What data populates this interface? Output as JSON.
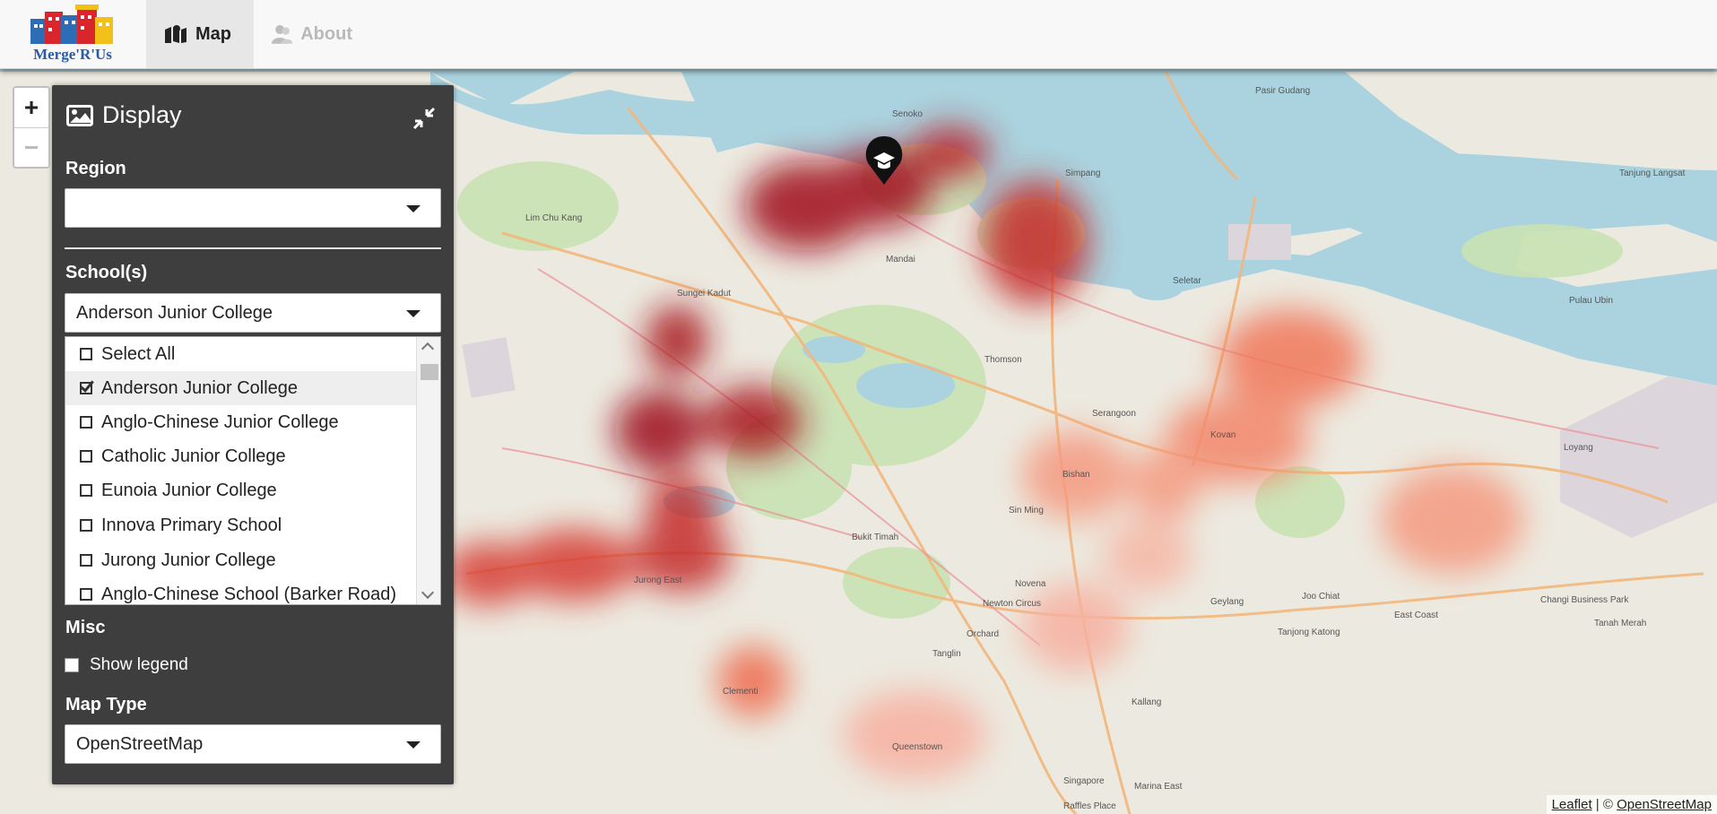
{
  "brand": {
    "text": "Merge'R'Us"
  },
  "nav": {
    "tabs": [
      {
        "label": "Map",
        "icon": "map-icon",
        "active": true
      },
      {
        "label": "About",
        "icon": "users-icon",
        "active": false
      }
    ]
  },
  "zoom": {
    "in": "+",
    "out": "−"
  },
  "sidebar": {
    "title": "Display",
    "region": {
      "label": "Region",
      "value": ""
    },
    "schools": {
      "label": "School(s)",
      "selected": "Anderson Junior College",
      "options": [
        {
          "label": "Select All",
          "checked": false
        },
        {
          "label": "Anderson Junior College",
          "checked": true
        },
        {
          "label": "Anglo-Chinese Junior College",
          "checked": false
        },
        {
          "label": "Catholic Junior College",
          "checked": false
        },
        {
          "label": "Eunoia Junior College",
          "checked": false
        },
        {
          "label": "Innova Primary School",
          "checked": false
        },
        {
          "label": "Jurong Junior College",
          "checked": false
        },
        {
          "label": "Anglo-Chinese School (Barker Road)",
          "checked": false
        }
      ]
    },
    "misc": {
      "label": "Misc",
      "show_legend_label": "Show legend",
      "show_legend": false
    },
    "map_type": {
      "label": "Map Type",
      "value": "OpenStreetMap"
    }
  },
  "map_labels": [
    "Senoko",
    "Pasir Gudang",
    "Lim Chu Kang",
    "Sungei Kadut",
    "Mandai",
    "Seletar",
    "Pulau Ubin",
    "Thomson",
    "Serangoon",
    "Bishan",
    "Kovan",
    "Bukit Timah",
    "Novena",
    "Orchard",
    "Newton Circus",
    "Tanglin",
    "Geylang",
    "Joo Chiat",
    "Tanjong Katong",
    "East Coast",
    "Changi Business Park",
    "Tanah Merah",
    "Loyang",
    "Jurong East",
    "Singapore",
    "Marina East",
    "Kallang",
    "Simpang",
    "Tanjung Langsat",
    "Queenstown",
    "Clementi",
    "Sin Ming",
    "Raffles Place"
  ],
  "attribution": {
    "leaflet": "Leaflet",
    "sep": " | © ",
    "osm": "OpenStreetMap"
  },
  "colors": {
    "panel": "#3e3e3e",
    "heat_dark": "#a0101c",
    "heat_light": "#f3866a",
    "water": "#aad3df",
    "land": "#eaeae4"
  }
}
